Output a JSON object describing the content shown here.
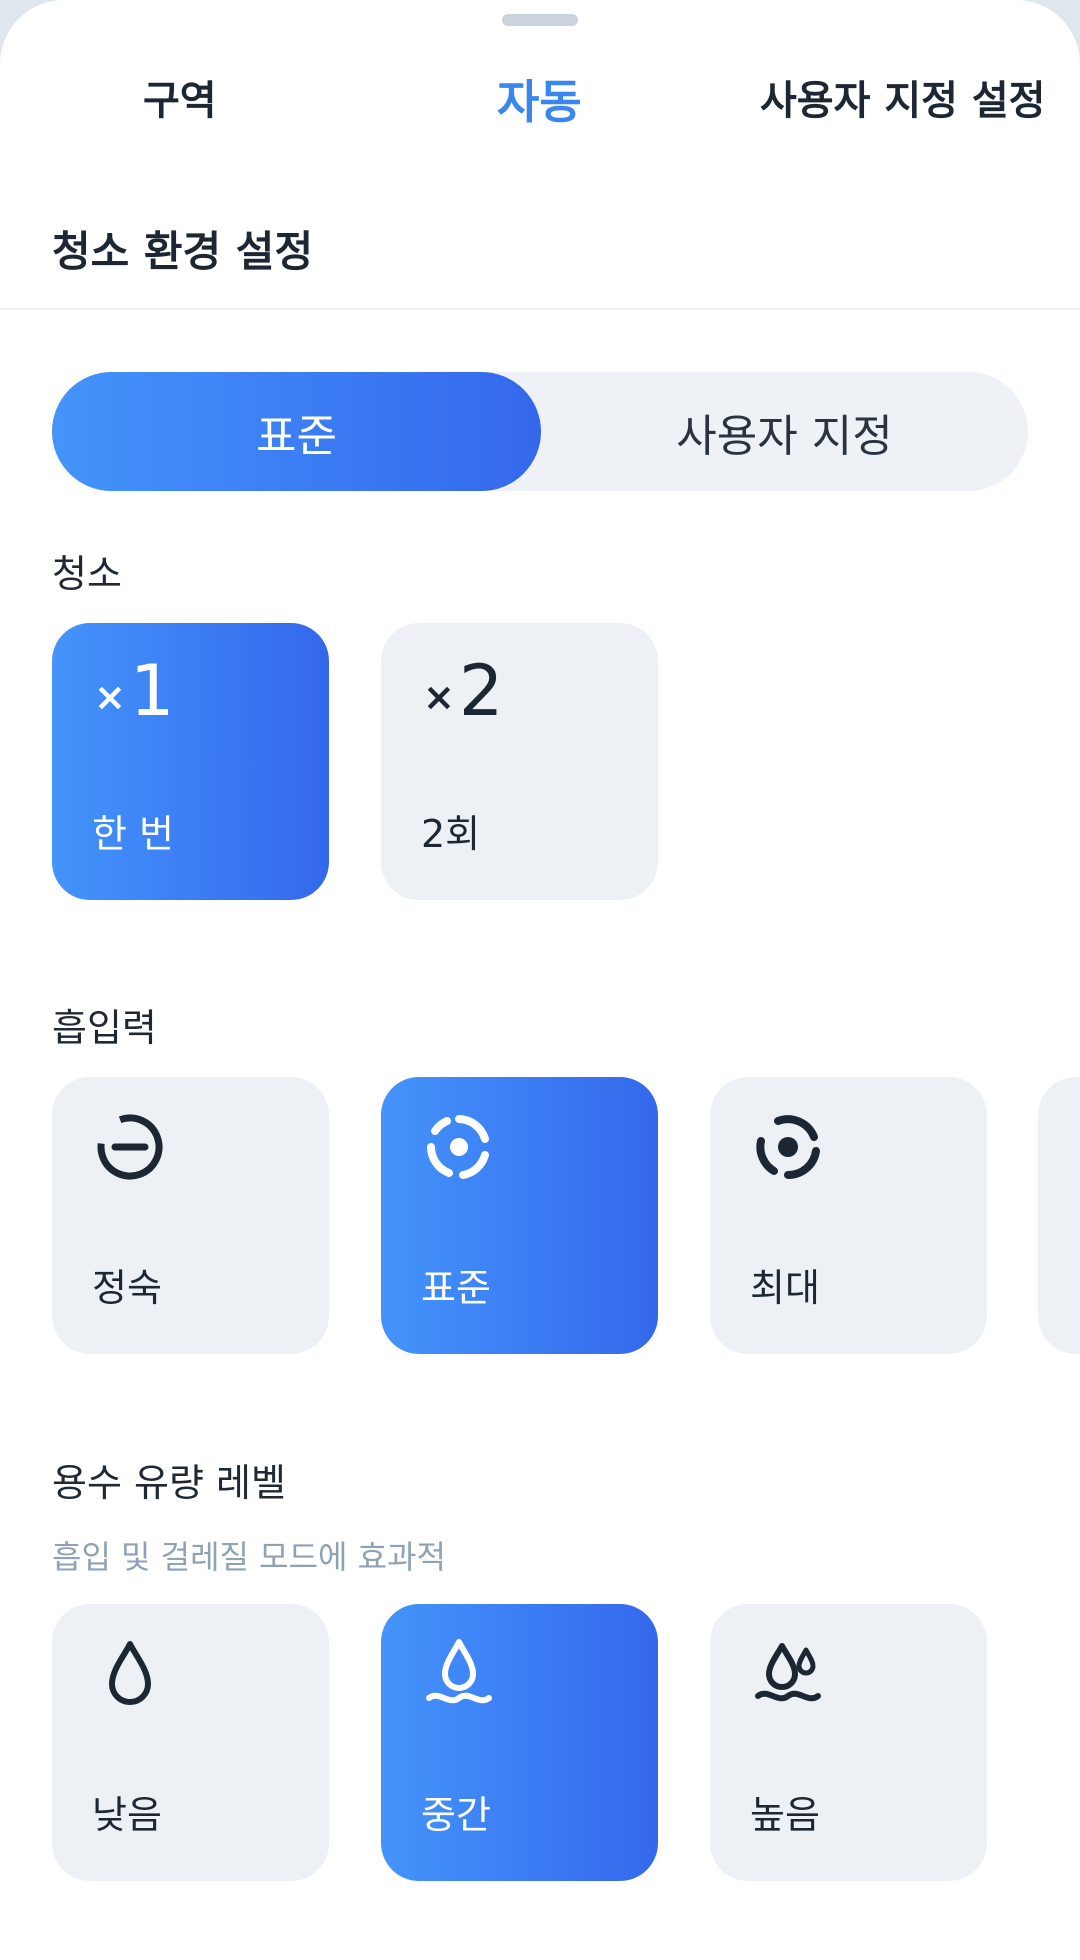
{
  "tabs": [
    {
      "label": "구역",
      "active": false
    },
    {
      "label": "자동",
      "active": true
    },
    {
      "label": "사용자 지정 설정",
      "active": false
    }
  ],
  "section_title": "청소 환경 설정",
  "mode_toggle": {
    "options": [
      "표준",
      "사용자 지정"
    ],
    "selected": "표준"
  },
  "cleaning": {
    "label": "청소",
    "options": [
      {
        "multiplier_prefix": "×",
        "multiplier": "1",
        "label": "한 번",
        "selected": true
      },
      {
        "multiplier_prefix": "×",
        "multiplier": "2",
        "label": "2회",
        "selected": false
      }
    ]
  },
  "suction": {
    "label": "흡입력",
    "options": [
      {
        "icon": "suction-quiet-icon",
        "label": "정숙",
        "selected": false
      },
      {
        "icon": "suction-standard-icon",
        "label": "표준",
        "selected": true
      },
      {
        "icon": "suction-max-icon",
        "label": "최대",
        "selected": false
      }
    ]
  },
  "water_flow": {
    "label": "용수 유량 레벨",
    "hint": "흡입 및 걸레질 모드에 효과적",
    "options": [
      {
        "icon": "water-low-icon",
        "label": "낮음",
        "selected": false
      },
      {
        "icon": "water-medium-icon",
        "label": "중간",
        "selected": true
      },
      {
        "icon": "water-high-icon",
        "label": "높음",
        "selected": false
      }
    ]
  },
  "colors": {
    "accent": "#3a86f0",
    "gradient_start": "#4494fb",
    "gradient_end": "#3468ec",
    "card_bg": "#edf1f5"
  }
}
